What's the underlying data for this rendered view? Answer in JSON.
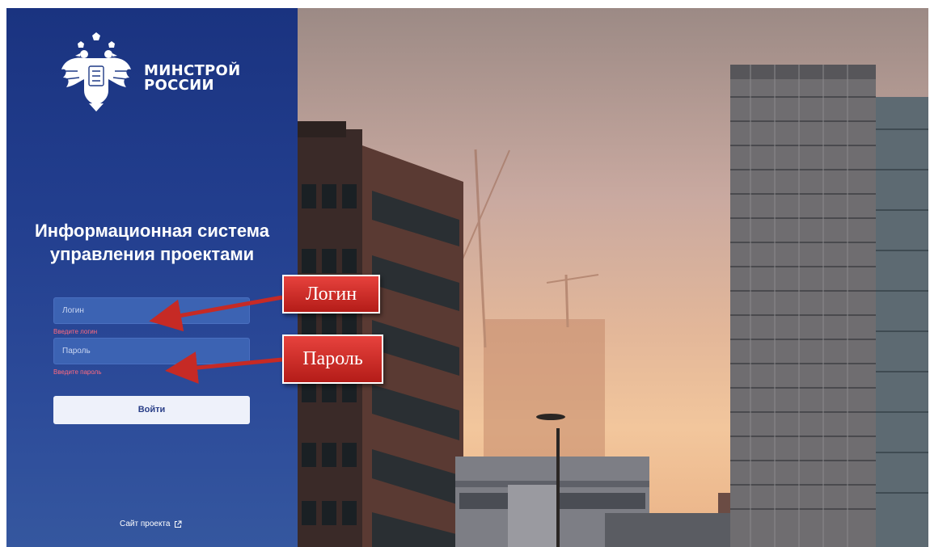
{
  "brand": {
    "line1": "МИНСТРОЙ",
    "line2": "РОССИИ",
    "emblem_icon": "coat-of-arms-icon"
  },
  "app": {
    "title_line1": "Информационная система",
    "title_line2": "управления проектами"
  },
  "form": {
    "login_placeholder": "Логин",
    "login_error": "Введите логин",
    "password_placeholder": "Пароль",
    "password_error": "Введите пароль",
    "submit_label": "Войти"
  },
  "footer": {
    "site_link": "Сайт проекта",
    "link_icon": "external-link-icon"
  },
  "annotations": {
    "login": "Логин",
    "password": "Пароль"
  },
  "colors": {
    "panel": "#1a3380",
    "error": "#ff6a7e",
    "callout": "#c62a25",
    "button": "#eef1fa"
  }
}
